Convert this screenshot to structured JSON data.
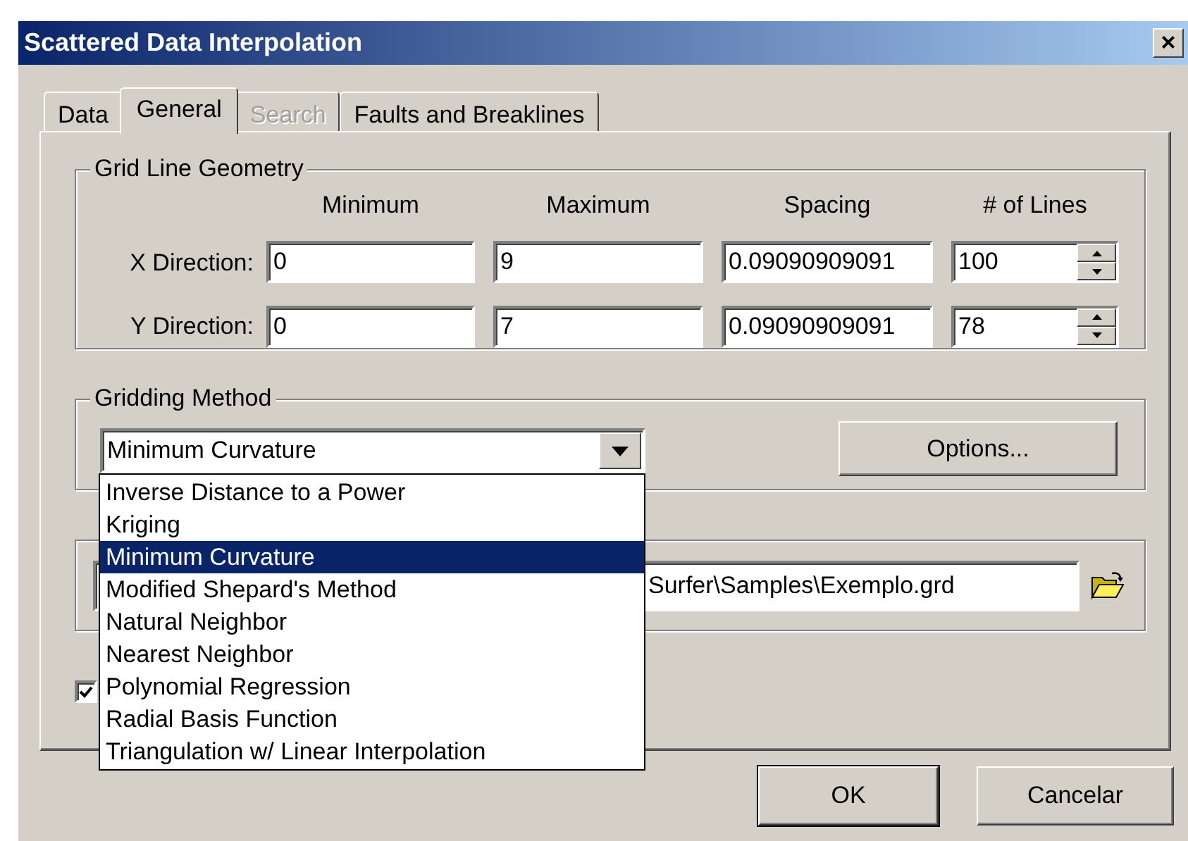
{
  "window": {
    "title": "Scattered Data Interpolation",
    "close": "×"
  },
  "tabs": [
    {
      "label": "Data",
      "selected": false,
      "disabled": false
    },
    {
      "label": "General",
      "selected": true,
      "disabled": false
    },
    {
      "label": "Search",
      "selected": false,
      "disabled": true
    },
    {
      "label": "Faults and Breaklines",
      "selected": false,
      "disabled": false
    }
  ],
  "grid_line_geometry": {
    "title": "Grid Line Geometry",
    "columns": [
      "Minimum",
      "Maximum",
      "Spacing",
      "# of Lines"
    ],
    "rows": [
      {
        "label": "X Direction:",
        "minimum": "0",
        "maximum": "9",
        "spacing": "0.09090909091",
        "lines": "100"
      },
      {
        "label": "Y Direction:",
        "minimum": "0",
        "maximum": "7",
        "spacing": "0.09090909091",
        "lines": "78"
      }
    ]
  },
  "gridding_method": {
    "title": "Gridding Method",
    "value": "Minimum Curvature",
    "expanded": true,
    "options_button": "Options...",
    "items": [
      {
        "label": "Inverse Distance to a Power",
        "selected": false
      },
      {
        "label": "Kriging",
        "selected": false
      },
      {
        "label": "Minimum Curvature",
        "selected": true
      },
      {
        "label": "Modified Shepard's Method",
        "selected": false
      },
      {
        "label": "Natural Neighbor",
        "selected": false
      },
      {
        "label": "Nearest Neighbor",
        "selected": false
      },
      {
        "label": "Polynomial Regression",
        "selected": false
      },
      {
        "label": "Radial Basis Function",
        "selected": false
      },
      {
        "label": "Triangulation w/ Linear Interpolation",
        "selected": false
      }
    ]
  },
  "output_grid": {
    "path": "Surfer\\Samples\\Exemplo.grd"
  },
  "report_checkbox": {
    "checked": true
  },
  "buttons": [
    "OK",
    "Cancelar"
  ]
}
